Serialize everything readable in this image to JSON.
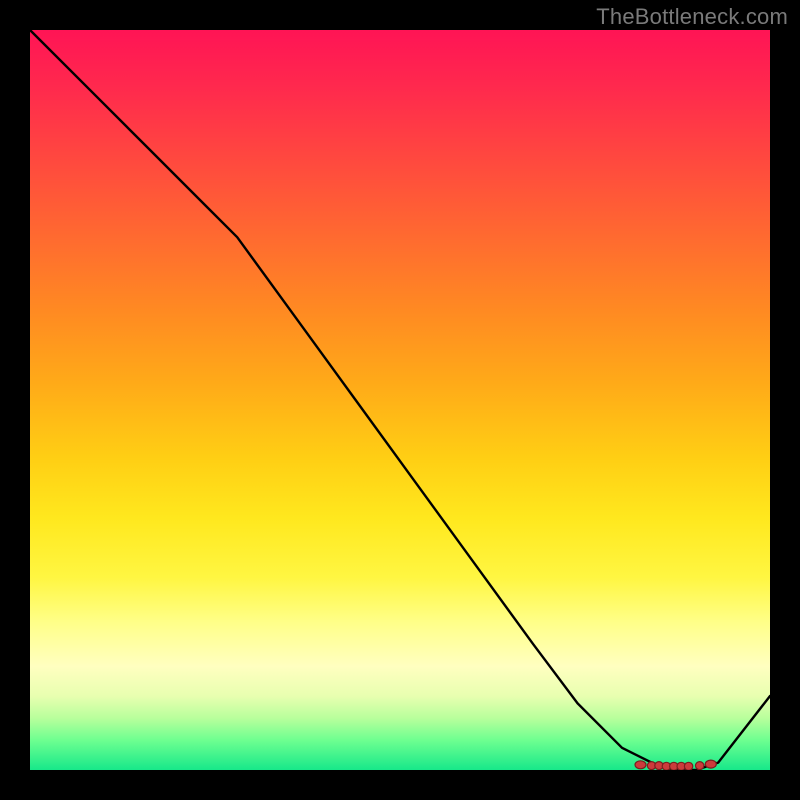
{
  "watermark": "TheBottleneck.com",
  "chart_data": {
    "type": "line",
    "title": "",
    "xlabel": "",
    "ylabel": "",
    "ylim": [
      0,
      100
    ],
    "xlim": [
      0,
      100
    ],
    "x": [
      0,
      8,
      16,
      24,
      28,
      36,
      44,
      52,
      60,
      68,
      74,
      80,
      84,
      87,
      90,
      93,
      100
    ],
    "values": [
      100,
      92,
      84,
      76,
      72,
      61,
      50,
      39,
      28,
      17,
      9,
      3,
      1,
      0,
      0,
      1,
      10
    ],
    "flat_region": {
      "x_start": 82,
      "x_end": 92,
      "y": 0.5
    },
    "dots": {
      "x": [
        82.5,
        84.0,
        85.0,
        86.0,
        87.0,
        88.0,
        89.0,
        90.5,
        92.0
      ],
      "y": [
        0.7,
        0.6,
        0.6,
        0.5,
        0.5,
        0.5,
        0.5,
        0.6,
        0.8
      ]
    },
    "background_gradient": {
      "stops": [
        {
          "pct": 0,
          "color": "#ff1455"
        },
        {
          "pct": 50,
          "color": "#ffcf14"
        },
        {
          "pct": 85,
          "color": "#ffffc0"
        },
        {
          "pct": 100,
          "color": "#17e88a"
        }
      ]
    }
  }
}
